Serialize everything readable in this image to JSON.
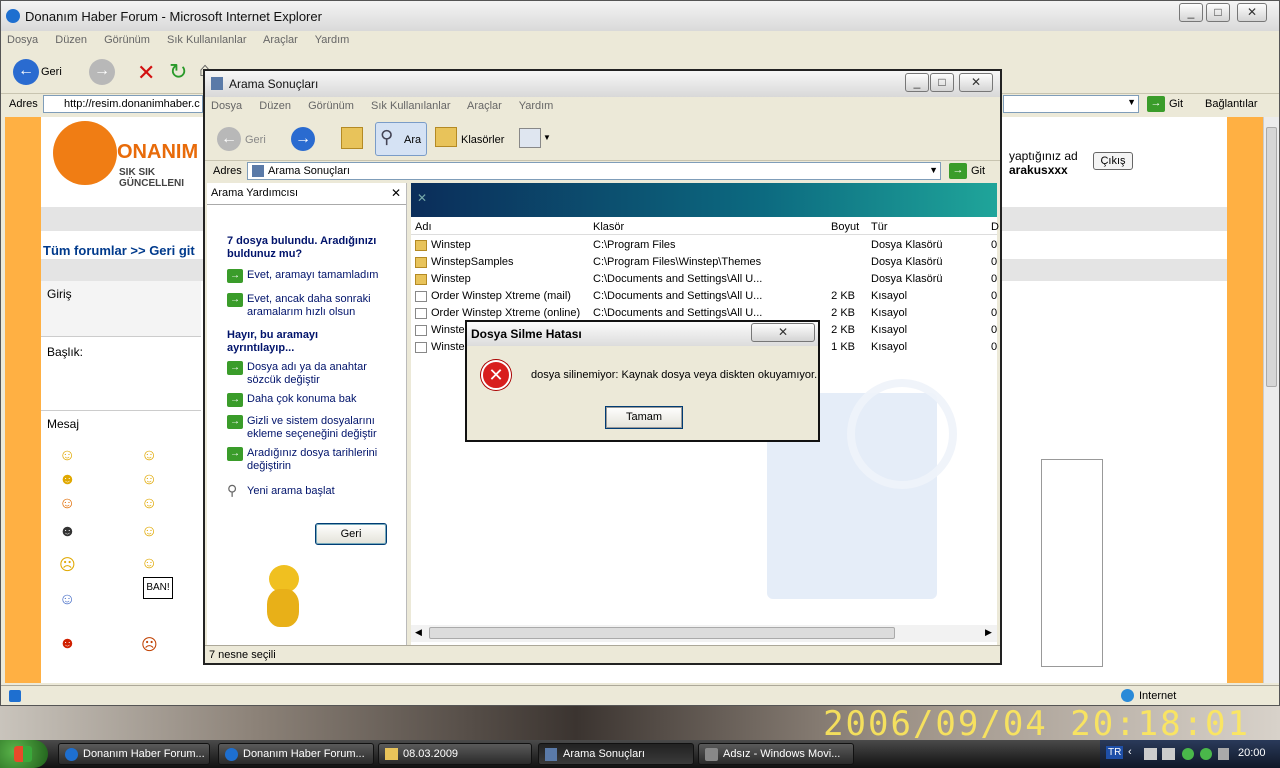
{
  "ie": {
    "title": "Donanım Haber Forum - Microsoft Internet Explorer",
    "menu": [
      "Dosya",
      "Düzen",
      "Görünüm",
      "Sık Kullanılanlar",
      "Araçlar",
      "Yardım"
    ],
    "back_label": "Geri",
    "address_label": "Adres",
    "address_value": "http://resim.donanimhaber.c",
    "go_label": "Git",
    "links_label": "Bağlantılar",
    "status_zone": "Internet",
    "page": {
      "logo_sub": "SIK SIK GÜNCELLENI",
      "logo_main": "ONANIM",
      "breadcrumb": "Tüm forumlar >> Geri git",
      "login_text": "yaptığınız ad",
      "username": "arakusxxx",
      "logout": "Çıkış",
      "label_giris": "Giriş",
      "label_baslik": "Başlık:",
      "label_mesaj": "Mesaj",
      "ban_label": "BAN!"
    }
  },
  "search": {
    "title": "Arama Sonuçları",
    "menu": [
      "Dosya",
      "Düzen",
      "Görünüm",
      "Sık Kullanılanlar",
      "Araçlar",
      "Yardım"
    ],
    "back_label": "Geri",
    "search_label": "Ara",
    "folders_label": "Klasörler",
    "address_label": "Adres",
    "address_value": "Arama Sonuçları",
    "go_label": "Git",
    "helper_title": "Arama Yardımcısı",
    "found_text": "7 dosya bulundu. Aradığınızı buldunuz mu?",
    "yes_items": [
      "Evet, aramayı tamamladım",
      "Evet, ancak daha sonraki aramalarım hızlı olsun"
    ],
    "no_heading": "Hayır, bu aramayı ayrıntılayıp...",
    "no_items": [
      "Dosya adı ya da anahtar sözcük değiştir",
      "Daha çok konuma bak",
      "Gizli ve sistem dosyalarını ekleme seçeneğini değiştir",
      "Aradığınız dosya tarihlerini değiştirin"
    ],
    "new_search": "Yeni arama başlat",
    "back_button": "Geri",
    "status": "7 nesne seçili",
    "columns": [
      "Adı",
      "Klasör",
      "Boyut",
      "Tür",
      "D"
    ],
    "rows": [
      {
        "name": "Winstep",
        "folder": "C:\\Program Files",
        "size": "",
        "type": "Dosya Klasörü",
        "d": "0"
      },
      {
        "name": "WinstepSamples",
        "folder": "C:\\Program Files\\Winstep\\Themes",
        "size": "",
        "type": "Dosya Klasörü",
        "d": "0"
      },
      {
        "name": "Winstep",
        "folder": "C:\\Documents and Settings\\All U...",
        "size": "",
        "type": "Dosya Klasörü",
        "d": "0"
      },
      {
        "name": "Order Winstep Xtreme (mail)",
        "folder": "C:\\Documents and Settings\\All U...",
        "size": "2 KB",
        "type": "Kısayol",
        "d": "0"
      },
      {
        "name": "Order Winstep Xtreme (online)",
        "folder": "C:\\Documents and Settings\\All U...",
        "size": "2 KB",
        "type": "Kısayol",
        "d": "0"
      },
      {
        "name": "Winste",
        "folder": "",
        "size": "2 KB",
        "type": "Kısayol",
        "d": "0"
      },
      {
        "name": "Winste",
        "folder": "",
        "size": "1 KB",
        "type": "Kısayol",
        "d": "0"
      }
    ]
  },
  "dialog": {
    "title": "Dosya Silme Hatası",
    "message": "dosya silinemiyor: Kaynak dosya veya diskten okuyamıyor.",
    "ok": "Tamam"
  },
  "taskbar": {
    "items": [
      "Donanım Haber Forum...",
      "Donanım Haber Forum...",
      "08.03.2009",
      "Arama Sonuçları",
      "Adsız - Windows Movi..."
    ],
    "lang": "TR",
    "clock": "20:00"
  },
  "wallpaper_stamp": "2006/09/04  20:18:01"
}
